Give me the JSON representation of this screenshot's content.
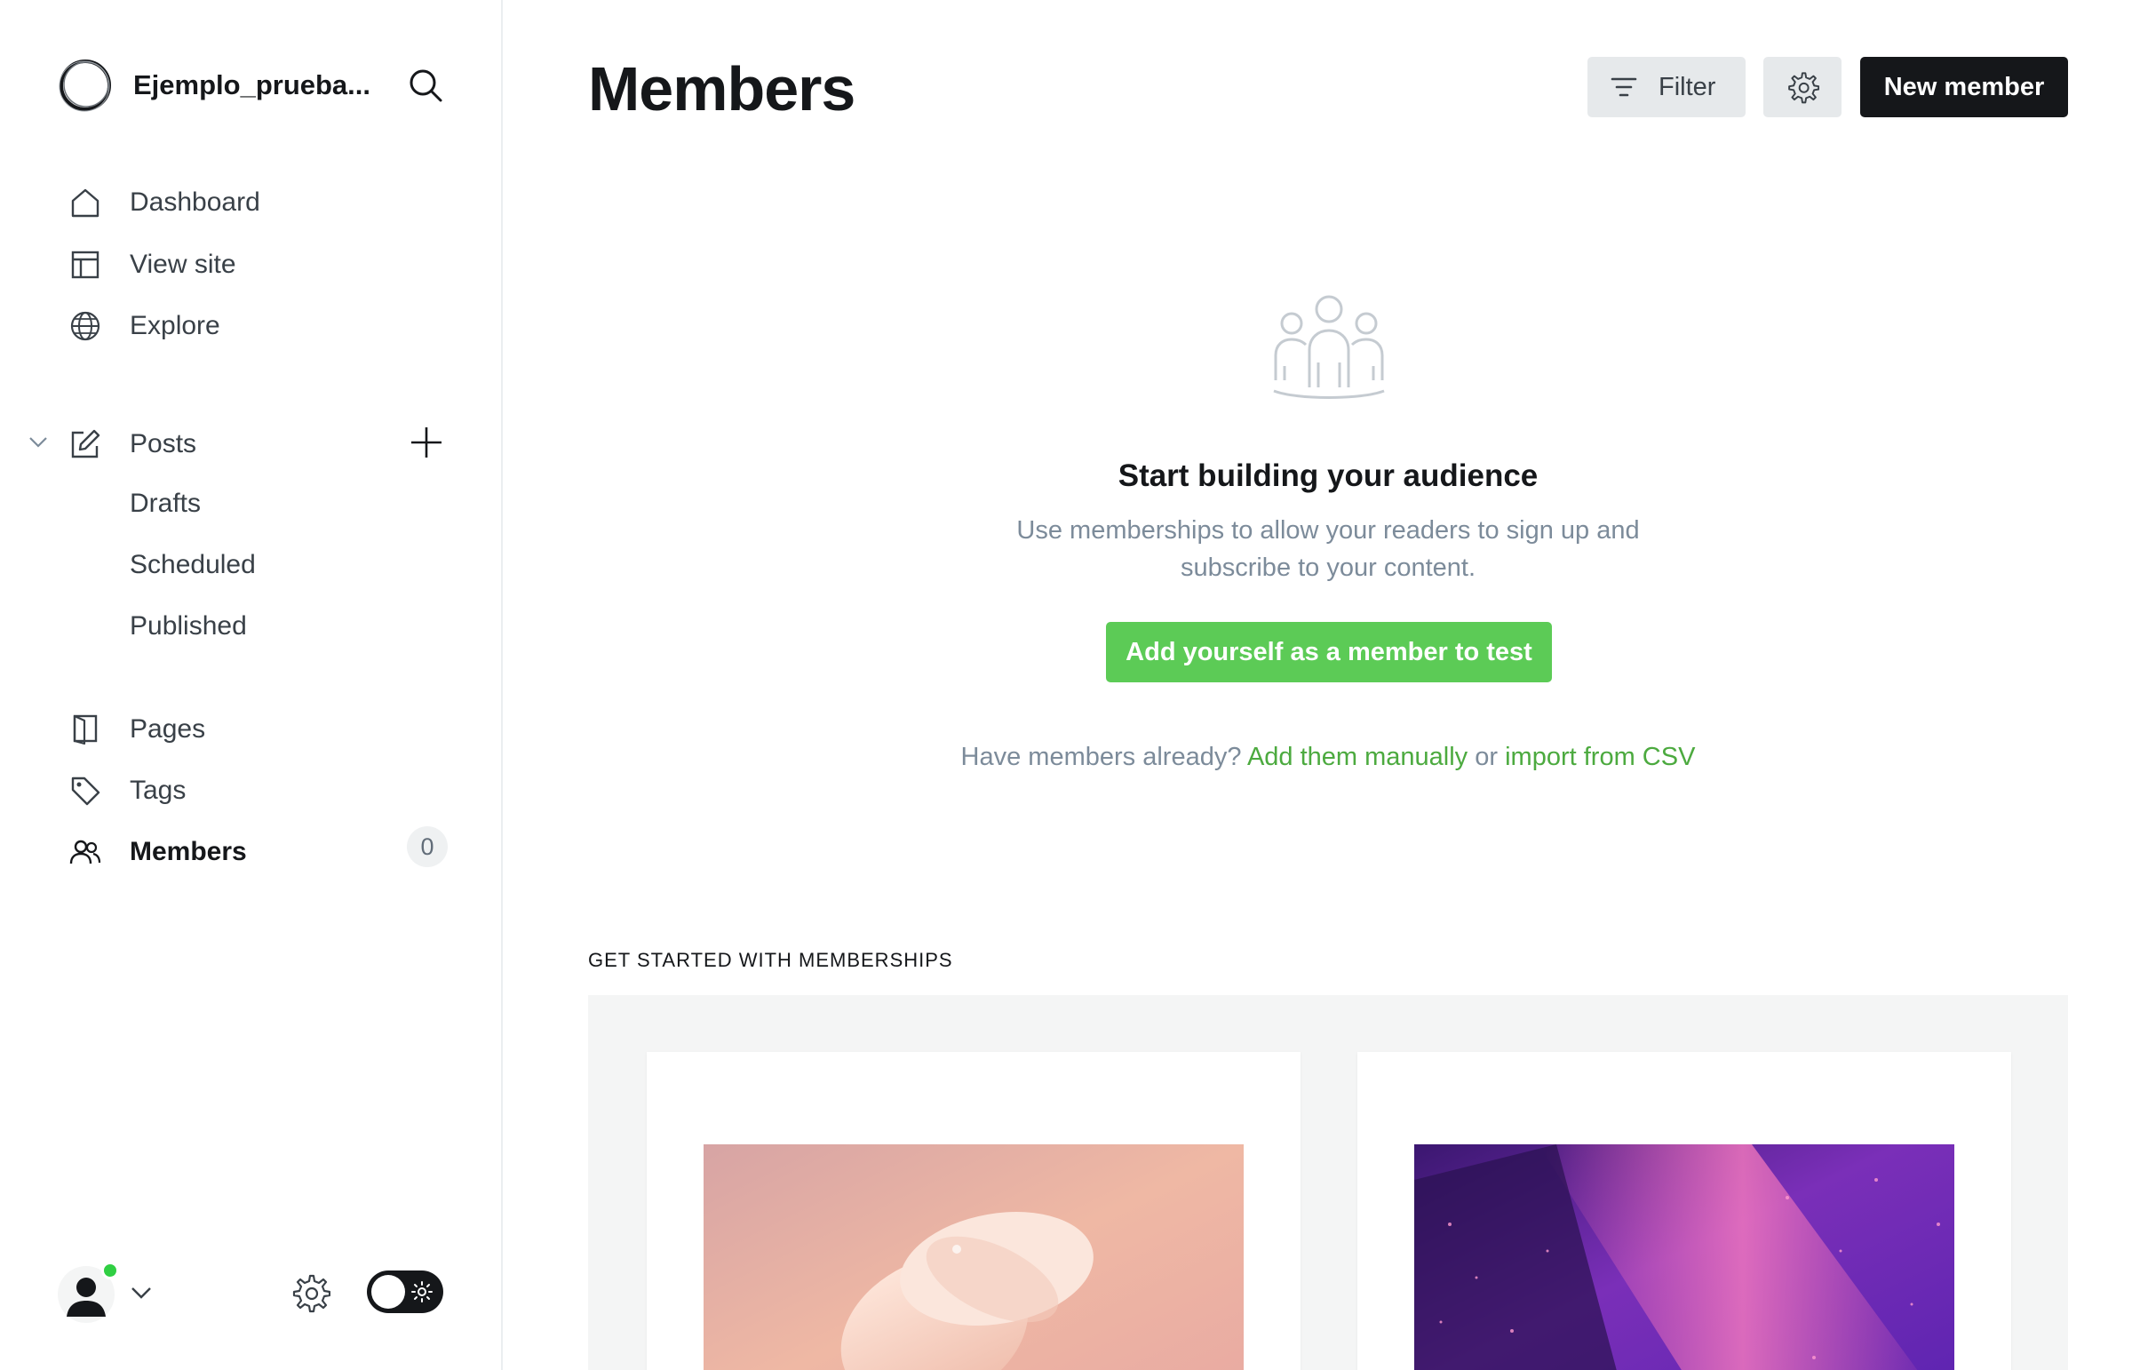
{
  "sidebar": {
    "site_name": "Ejemplo_prueba...",
    "nav": [
      {
        "label": "Dashboard",
        "icon": "home-icon"
      },
      {
        "label": "View site",
        "icon": "layout-icon"
      },
      {
        "label": "Explore",
        "icon": "globe-icon"
      }
    ],
    "posts": {
      "label": "Posts",
      "icon": "edit-icon",
      "sub": [
        "Drafts",
        "Scheduled",
        "Published"
      ]
    },
    "nav2": [
      {
        "label": "Pages",
        "icon": "page-icon"
      },
      {
        "label": "Tags",
        "icon": "tag-icon"
      },
      {
        "label": "Members",
        "icon": "members-icon",
        "active": true,
        "count": "0"
      }
    ]
  },
  "header": {
    "title": "Members",
    "filter_label": "Filter",
    "new_member_label": "New member"
  },
  "empty_state": {
    "title": "Start building your audience",
    "description": "Use memberships to allow your readers to sign up and subscribe to your content.",
    "cta_label": "Add yourself as a member to test",
    "import_prefix": "Have members already?",
    "add_manually_label": "Add them manually",
    "or_label": "or",
    "import_csv_label": "import from CSV"
  },
  "get_started": {
    "label": "GET STARTED WITH MEMBERSHIPS"
  },
  "colors": {
    "accent_green": "#5ccb56",
    "link_green": "#4caa3f",
    "dark": "#15171a",
    "online_status": "#30cf43"
  }
}
